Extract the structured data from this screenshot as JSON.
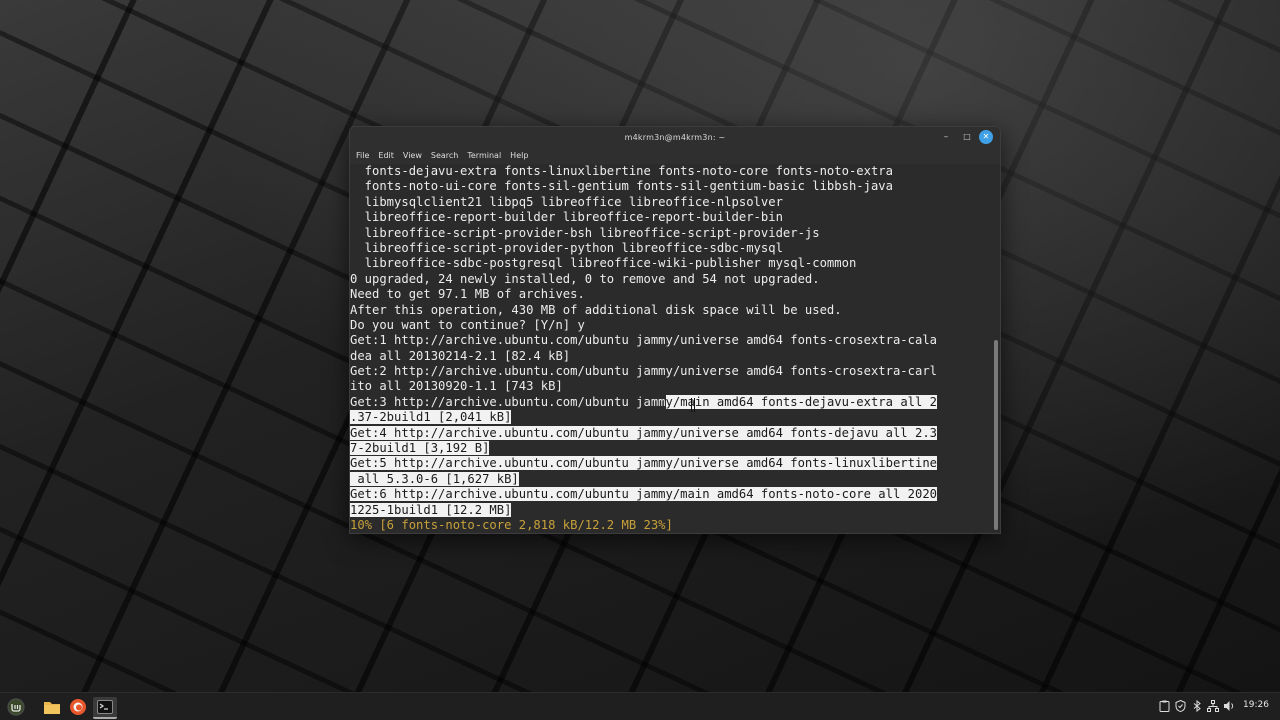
{
  "window": {
    "title": "m4krm3n@m4krm3n: ~",
    "minimize_glyph": "–",
    "maximize_glyph": "□",
    "close_glyph": "✕"
  },
  "menu": [
    "File",
    "Edit",
    "View",
    "Search",
    "Terminal",
    "Help"
  ],
  "terminal_lines": [
    [
      {
        "t": "  fonts-dejavu-extra fonts-linuxlibertine fonts-noto-core fonts-noto-extra"
      }
    ],
    [
      {
        "t": "  fonts-noto-ui-core fonts-sil-gentium fonts-sil-gentium-basic libbsh-java"
      }
    ],
    [
      {
        "t": "  libmysqlclient21 libpq5 libreoffice libreoffice-nlpsolver"
      }
    ],
    [
      {
        "t": "  libreoffice-report-builder libreoffice-report-builder-bin"
      }
    ],
    [
      {
        "t": "  libreoffice-script-provider-bsh libreoffice-script-provider-js"
      }
    ],
    [
      {
        "t": "  libreoffice-script-provider-python libreoffice-sdbc-mysql"
      }
    ],
    [
      {
        "t": "  libreoffice-sdbc-postgresql libreoffice-wiki-publisher mysql-common"
      }
    ],
    [
      {
        "t": "0 upgraded, 24 newly installed, 0 to remove and 54 not upgraded."
      }
    ],
    [
      {
        "t": "Need to get 97.1 MB of archives."
      }
    ],
    [
      {
        "t": "After this operation, 430 MB of additional disk space will be used."
      }
    ],
    [
      {
        "t": "Do you want to continue? [Y/n] y"
      }
    ],
    [
      {
        "t": "Get:1 http://archive.ubuntu.com/ubuntu jammy/universe amd64 fonts-crosextra-cala"
      }
    ],
    [
      {
        "t": "dea all 20130214-2.1 [82.4 kB]"
      }
    ],
    [
      {
        "t": "Get:2 http://archive.ubuntu.com/ubuntu jammy/universe amd64 fonts-crosextra-carl"
      }
    ],
    [
      {
        "t": "ito all 20130920-1.1 [743 kB]"
      }
    ],
    [
      {
        "t": "Get:3 http://archive.ubuntu.com/ubuntu jamm"
      },
      {
        "t": "y/main amd64 fonts-dejavu-extra all 2",
        "sel": true
      }
    ],
    [
      {
        "t": ".37-2build1 [2,041 kB]",
        "sel": true
      }
    ],
    [
      {
        "t": "Get:4 http://archive.ubuntu.com/ubuntu jammy/universe amd64 fonts-dejavu all 2.3",
        "sel": true
      }
    ],
    [
      {
        "t": "7-2build1 [3,192 B]",
        "sel": true
      }
    ],
    [
      {
        "t": "Get:5 http://archive.ubuntu.com/ubuntu jammy/universe amd64 fonts-linuxlibertine",
        "sel": true
      }
    ],
    [
      {
        "t": " all 5.3.0-6 [1,627 kB]",
        "sel": true
      }
    ],
    [
      {
        "t": "Get:6 http://archive.ubuntu.com/ubuntu jammy/main amd64 fonts-noto-core all 2020",
        "sel": true
      }
    ],
    [
      {
        "t": "1225-1build1 [12.2 MB]",
        "sel": true
      }
    ],
    [
      {
        "t": "10% [6 fonts-noto-core 2,818 kB/12.2 MB 23%]",
        "progress": true
      }
    ]
  ],
  "taskbar": {
    "menu_icon": "linux-mint-icon",
    "files_icon": "folder-icon",
    "browser_icon": "firefox-icon",
    "terminal_icon": "terminal-icon",
    "tray_icons": [
      "clipboard-icon",
      "shield-icon",
      "bluetooth-icon",
      "network-icon",
      "volume-icon",
      "battery-icon"
    ],
    "clock": "19:26",
    "colors": {
      "folder": "#e8b64c",
      "firefox": "#e8572c",
      "mint": "#8bc34a"
    }
  }
}
